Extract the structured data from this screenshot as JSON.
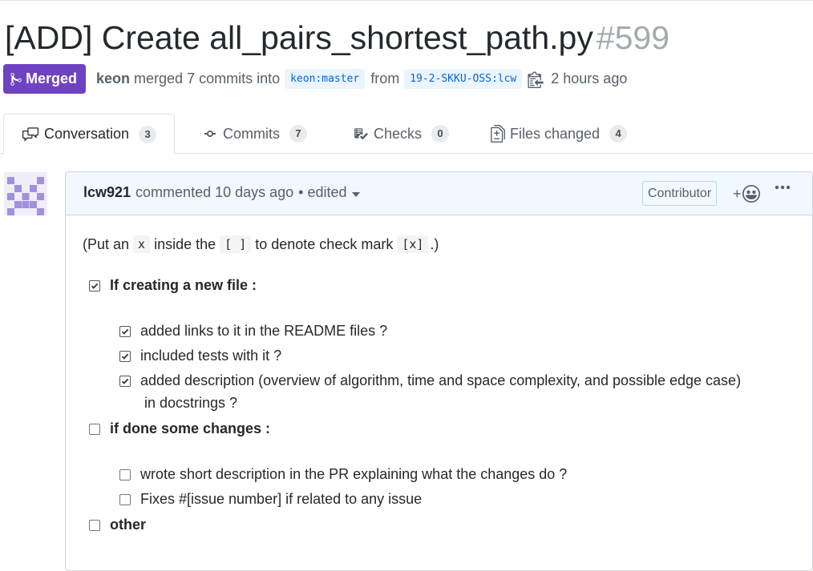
{
  "pr": {
    "title": "[ADD] Create all_pairs_shortest_path.py",
    "number": "#599",
    "state": "Merged",
    "author": "keon",
    "merged_text": "merged 7 commits into",
    "base_branch": "keon:master",
    "from_text": "from",
    "head_branch": "19-2-SKKU-OSS:lcw",
    "time": "2 hours ago"
  },
  "tabs": [
    {
      "label": "Conversation",
      "count": "3",
      "icon": "comment-discussion-icon"
    },
    {
      "label": "Commits",
      "count": "7",
      "icon": "git-commit-icon"
    },
    {
      "label": "Checks",
      "count": "0",
      "icon": "checklist-icon"
    },
    {
      "label": "Files changed",
      "count": "4",
      "icon": "file-diff-icon"
    }
  ],
  "comment": {
    "author": "lcw921",
    "action": "commented 10 days ago",
    "edited": "• edited",
    "badge": "Contributor",
    "react_plus": "+",
    "intro": {
      "a": "(Put an",
      "code1": "x",
      "b": "inside the",
      "code2": "[ ]",
      "c": "to denote check mark",
      "code3": "[x]",
      "d": ".)"
    },
    "sections": [
      {
        "label": "If creating a new file :",
        "checked": true,
        "items": [
          {
            "text": "added links to it in the README files ?",
            "checked": true
          },
          {
            "text": "included tests with it ?",
            "checked": true
          },
          {
            "text": "added description (overview of algorithm, time and space complexity, and possible edge case)",
            "cont": "in docstrings ?",
            "checked": true
          }
        ]
      },
      {
        "label": "if done some changes :",
        "checked": false,
        "items": [
          {
            "text": "wrote short description in the PR explaining what the changes do ?",
            "checked": false
          },
          {
            "text": "Fixes #[issue number] if related to any issue",
            "checked": false
          }
        ]
      },
      {
        "label": "other",
        "checked": false,
        "items": []
      }
    ]
  },
  "colors": {
    "merged": "#6f42c1",
    "branch_text": "#0366d6",
    "branch_bg": "#eaf5ff",
    "header_bg": "#f1f8ff",
    "avatar": "#a38fe0"
  }
}
